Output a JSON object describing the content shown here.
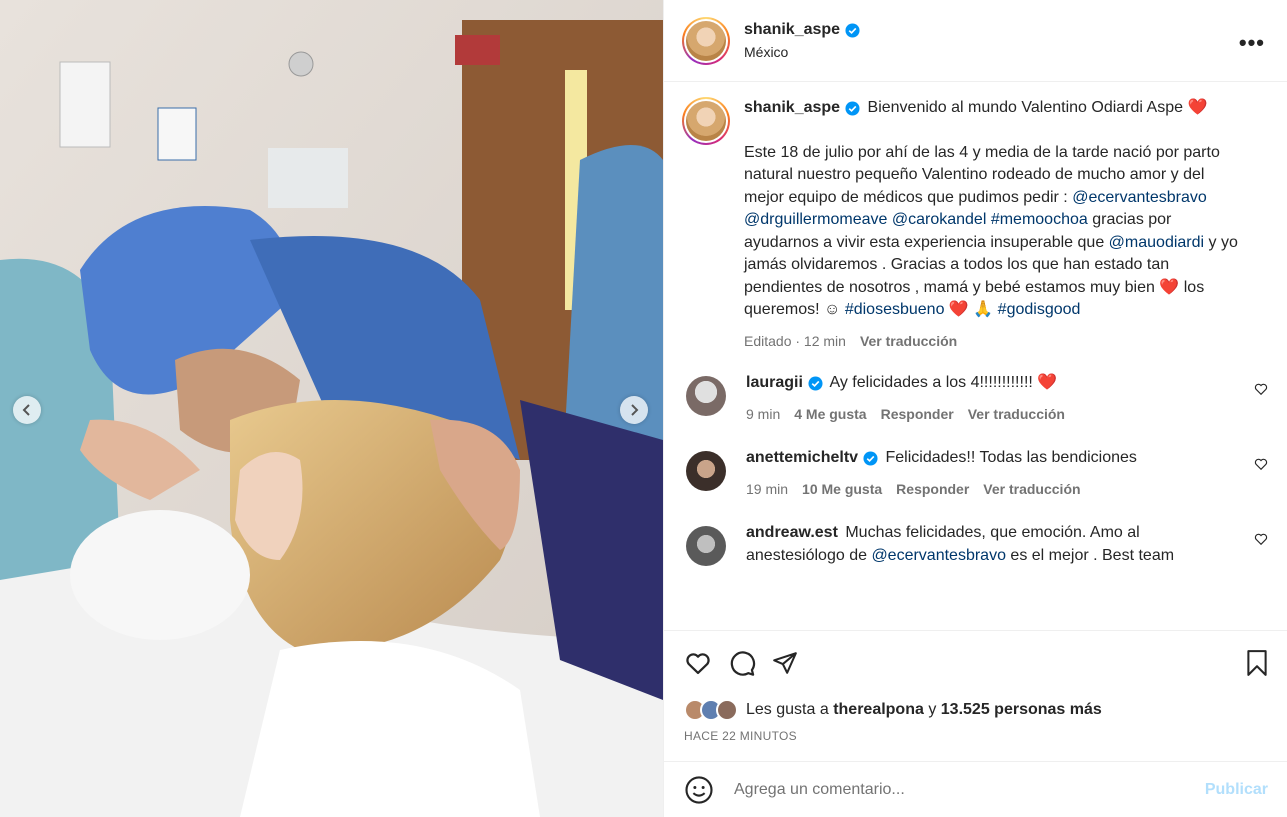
{
  "header": {
    "username": "shanik_aspe",
    "location": "México",
    "more_label": "•••"
  },
  "caption": {
    "username": "shanik_aspe",
    "first_line": "Bienvenido al mundo Valentino Odiardi Aspe",
    "heart": "❤️",
    "p1": "Este 18 de julio por ahí de las 4 y media de la tarde nació por parto natural nuestro pequeño Valentino rodeado de mucho amor y del mejor equipo de médicos que pudimos pedir :",
    "mention1": "@ecervantesbravo",
    "mention2": "@drguillermomeave",
    "mention3": "@carokandel",
    "mention4": "#memoochoa",
    "p2": "gracias por ayudarnos a vivir esta experiencia insuperable que",
    "mention5": "@mauodiardi",
    "p3": "y yo jamás olvidaremos . Gracias a todos los que han estado tan pendientes de nosotros , mamá y bebé estamos muy bien",
    "p4": "los queremos! ☺",
    "tag1": "#diosesbueno",
    "pray": "🙏",
    "tag2": "#godisgood",
    "edited": "Editado · 12 min",
    "translate": "Ver traducción"
  },
  "comments": [
    {
      "username": "lauragii",
      "text": "Ay felicidades a los 4!!!!!!!!!!!!",
      "heart": "❤️",
      "time": "9 min",
      "likes": "4 Me gusta",
      "reply": "Responder",
      "translate": "Ver traducción"
    },
    {
      "username": "anettemicheltv",
      "text": "Felicidades!! Todas las bendiciones",
      "time": "19 min",
      "likes": "10 Me gusta",
      "reply": "Responder",
      "translate": "Ver traducción"
    },
    {
      "username": "andreaw.est",
      "text": "Muchas felicidades, que emoción. Amo al anestesiólogo de",
      "mention": "@ecervantesbravo",
      "text2": "es el mejor . Best team"
    }
  ],
  "likes": {
    "prefix": "Les gusta a",
    "user": "therealpona",
    "conj": "y",
    "count": "13.525 personas más"
  },
  "time_ago": "HACE 22 MINUTOS",
  "comment_box": {
    "placeholder": "Agrega un comentario...",
    "publish": "Publicar"
  },
  "carousel": {
    "count": 4,
    "active": 1
  },
  "colors": {
    "verified": "#0095f6",
    "link": "#00376b",
    "publish": "#b2dffc"
  },
  "icons": [
    "chevron-left-icon",
    "chevron-right-icon",
    "heart-icon",
    "comment-icon",
    "share-icon",
    "bookmark-icon",
    "emoji-icon",
    "verified-icon"
  ]
}
